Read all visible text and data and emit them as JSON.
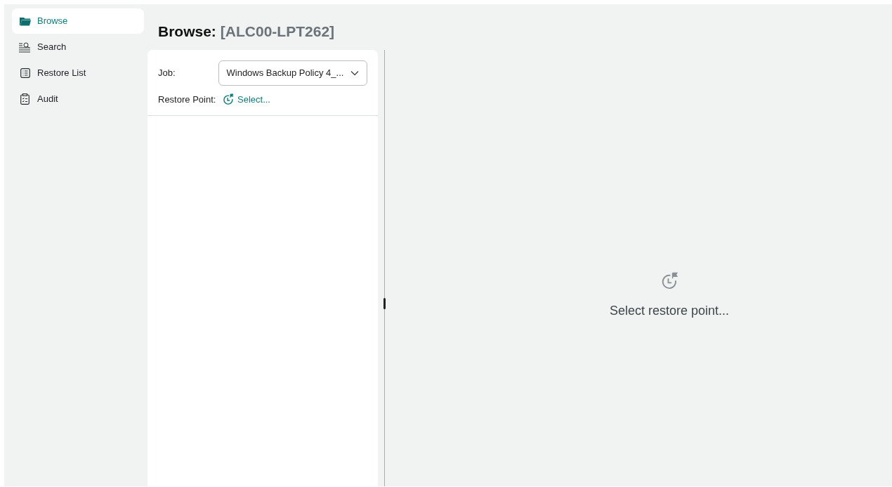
{
  "sidebar": {
    "items": [
      {
        "label": "Browse",
        "kind": "folder",
        "selected": true
      },
      {
        "label": "Search",
        "kind": "search",
        "selected": false
      },
      {
        "label": "Restore List",
        "kind": "list",
        "selected": false
      },
      {
        "label": "Audit",
        "kind": "clipboard",
        "selected": false
      }
    ]
  },
  "header": {
    "title": "Browse:",
    "subtitle": "[ALC00-LPT262]"
  },
  "form": {
    "job_label": "Job:",
    "job_value": "Windows Backup Policy 4_...",
    "restore_point_label": "Restore Point:",
    "restore_point_link": "Select..."
  },
  "empty_state": {
    "message": "Select restore point..."
  }
}
